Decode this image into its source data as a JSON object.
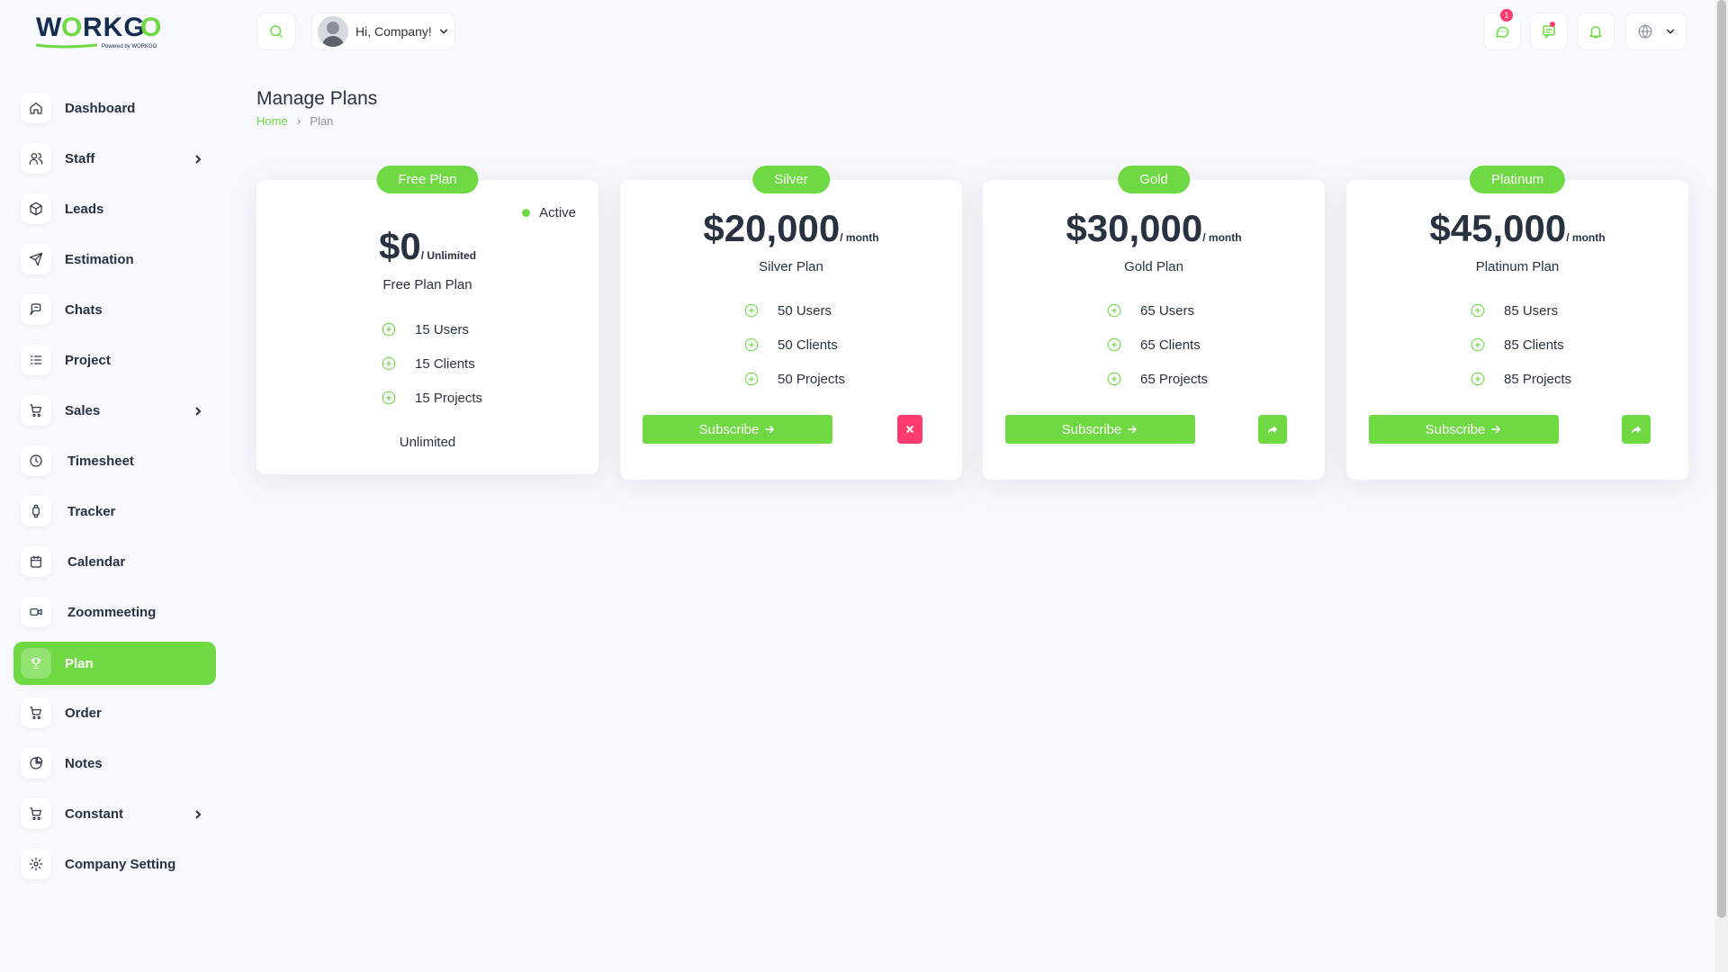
{
  "brand": {
    "name": "WORKGO",
    "tagline": "Powered by WORKGO",
    "accent": "#6fd943",
    "danger": "#ff3a6e"
  },
  "sidebar": {
    "items": [
      {
        "label": "Dashboard",
        "icon": "home-icon"
      },
      {
        "label": "Staff",
        "icon": "users-icon",
        "has_submenu": true
      },
      {
        "label": "Leads",
        "icon": "box-icon"
      },
      {
        "label": "Estimation",
        "icon": "send-icon"
      },
      {
        "label": "Chats",
        "icon": "chat-icon"
      },
      {
        "label": "Project",
        "icon": "list-icon"
      },
      {
        "label": "Sales",
        "icon": "cart-icon",
        "has_submenu": true
      },
      {
        "label": "Timesheet",
        "icon": "clock-icon"
      },
      {
        "label": "Tracker",
        "icon": "watch-icon"
      },
      {
        "label": "Calendar",
        "icon": "calendar-icon"
      },
      {
        "label": "Zoommeeting",
        "icon": "video-icon"
      },
      {
        "label": "Plan",
        "icon": "trophy-icon",
        "active": true
      },
      {
        "label": "Order",
        "icon": "cart-icon"
      },
      {
        "label": "Notes",
        "icon": "pie-icon"
      },
      {
        "label": "Constant",
        "icon": "cart-icon",
        "has_submenu": true
      },
      {
        "label": "Company Setting",
        "icon": "gear-icon"
      }
    ]
  },
  "header": {
    "user_greeting": "Hi, Company!",
    "messages_badge": "1"
  },
  "page": {
    "title": "Manage Plans",
    "breadcrumb_home": "Home",
    "breadcrumb_current": "Plan"
  },
  "plans": [
    {
      "badge": "Free Plan",
      "price": "$0",
      "per": "/ Unlimited",
      "name": "Free Plan Plan",
      "status": "Active",
      "features": [
        "15 Users",
        "15 Clients",
        "15 Projects"
      ],
      "footer": "Unlimited"
    },
    {
      "badge": "Silver",
      "price": "$20,000",
      "per": "/ month",
      "name": "Silver Plan",
      "features": [
        "50 Users",
        "50 Clients",
        "50 Projects"
      ],
      "subscribe_label": "Subscribe"
    },
    {
      "badge": "Gold",
      "price": "$30,000",
      "per": "/ month",
      "name": "Gold Plan",
      "features": [
        "65 Users",
        "65 Clients",
        "65 Projects"
      ],
      "subscribe_label": "Subscribe"
    },
    {
      "badge": "Platinum",
      "price": "$45,000",
      "per": "/ month",
      "name": "Platinum Plan",
      "features": [
        "85 Users",
        "85 Clients",
        "85 Projects"
      ],
      "subscribe_label": "Subscribe"
    }
  ]
}
